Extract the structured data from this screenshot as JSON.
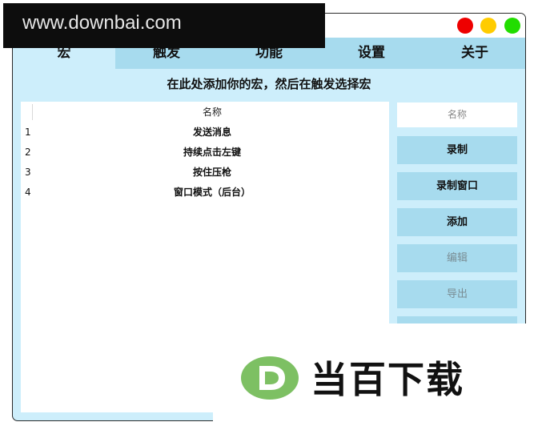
{
  "watermark": {
    "site": "www.downbai.com",
    "brand": "当百下载"
  },
  "tabs": [
    {
      "label": "宏"
    },
    {
      "label": "触发"
    },
    {
      "label": "功能"
    },
    {
      "label": "设置"
    },
    {
      "label": "关于"
    }
  ],
  "hint": "在此处添加你的宏，然后在触发选择宏",
  "table": {
    "header": "名称",
    "rows": [
      {
        "index": "1",
        "name": "发送消息"
      },
      {
        "index": "2",
        "name": "持续点击左键"
      },
      {
        "index": "3",
        "name": "按住压枪"
      },
      {
        "index": "4",
        "name": "窗口模式（后台）"
      }
    ]
  },
  "side": {
    "name_placeholder": "名称",
    "buttons": [
      {
        "label": "录制"
      },
      {
        "label": "录制窗口"
      },
      {
        "label": "添加"
      },
      {
        "label": "编辑"
      },
      {
        "label": "导出"
      },
      {
        "label": ""
      }
    ]
  },
  "colors": {
    "window_bg": "#cdeefb",
    "tab_bar": "#a7dbee",
    "button": "#a7dbee",
    "close": "#ee0000",
    "minimize": "#ffcc00",
    "maximize": "#22dd00",
    "logo_green": "#7dc063"
  }
}
